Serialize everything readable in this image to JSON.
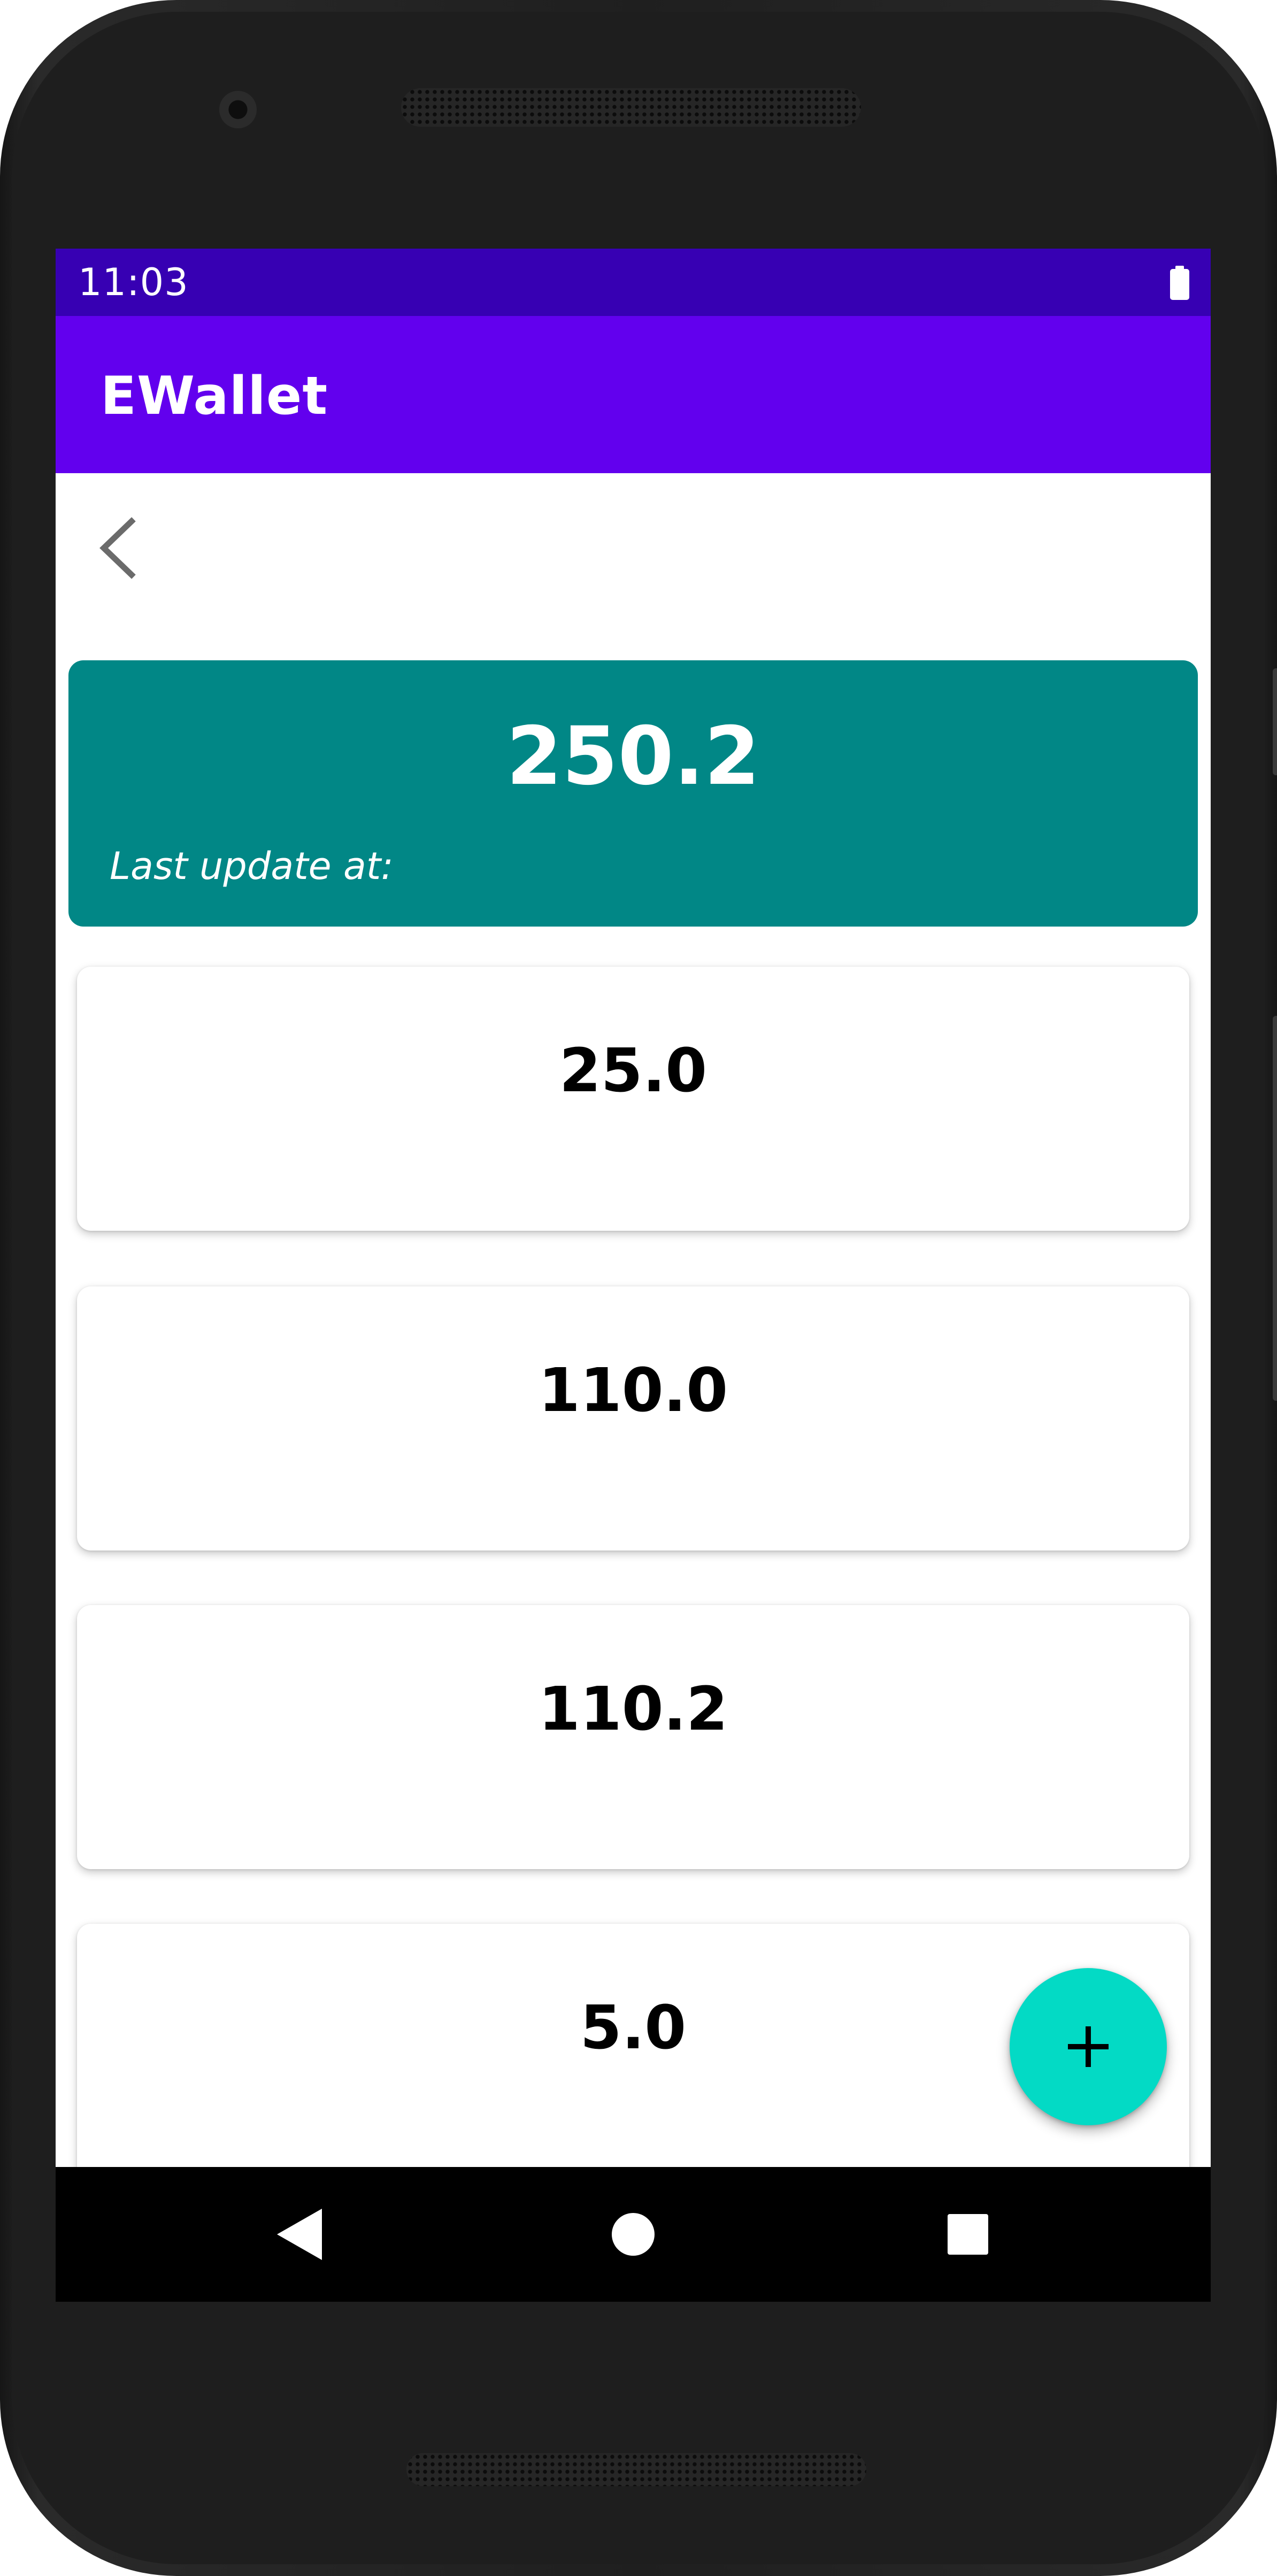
{
  "status_bar": {
    "time": "11:03",
    "battery_icon": "battery-full-icon"
  },
  "app_bar": {
    "title": "EWallet",
    "background": "#6200ee",
    "status_background": "#3700b3"
  },
  "back_button": {
    "icon": "chevron-left-icon"
  },
  "balance": {
    "amount": "250.2",
    "last_update_label": "Last update at:",
    "background": "#018786"
  },
  "transactions": [
    {
      "amount": "25.0"
    },
    {
      "amount": "110.0"
    },
    {
      "amount": "110.2"
    },
    {
      "amount": "5.0"
    }
  ],
  "fab": {
    "icon": "plus-icon",
    "background": "#03dac5"
  },
  "nav_bar": {
    "back_icon": "triangle-back-icon",
    "home_icon": "circle-home-icon",
    "recents_icon": "square-recents-icon"
  }
}
